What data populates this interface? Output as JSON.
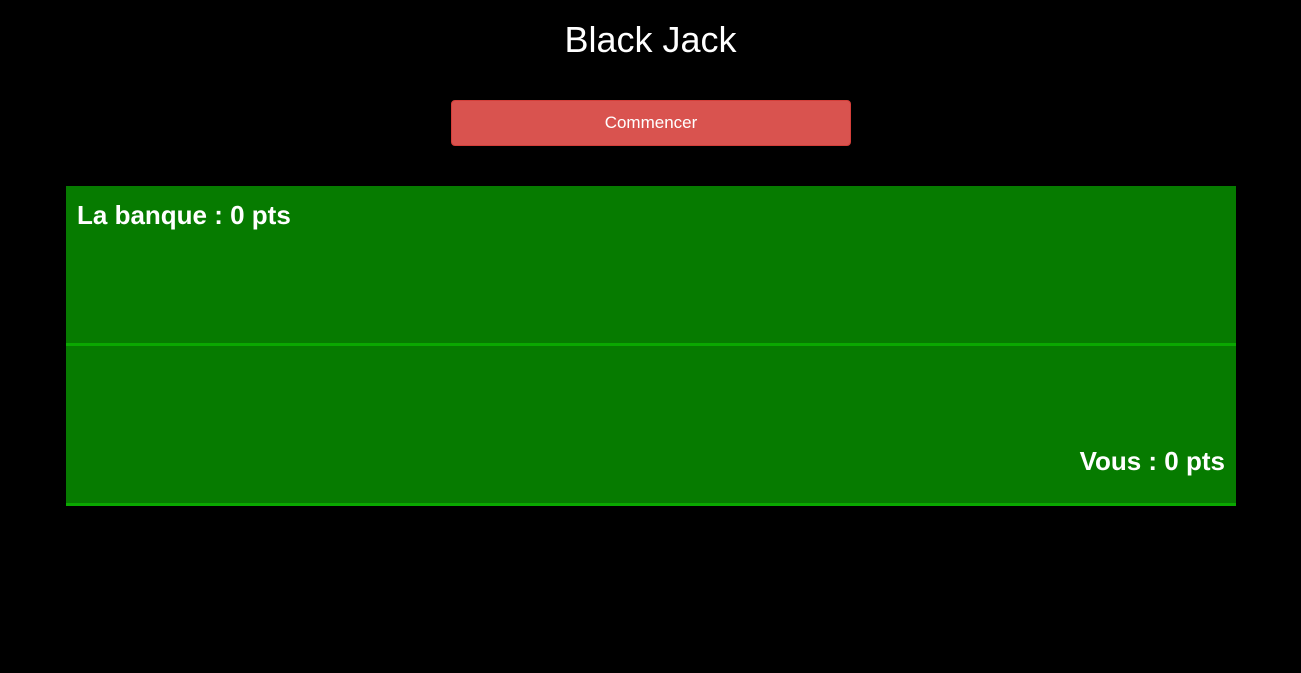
{
  "header": {
    "title": "Black Jack"
  },
  "controls": {
    "start_label": "Commencer"
  },
  "table": {
    "dealer_label": "La banque : 0 pts",
    "player_label": "Vous : 0 pts"
  },
  "colors": {
    "background": "#000000",
    "felt": "#067b00",
    "divider": "#0aa800",
    "start_button": "#d9534f",
    "text": "#ffffff"
  }
}
